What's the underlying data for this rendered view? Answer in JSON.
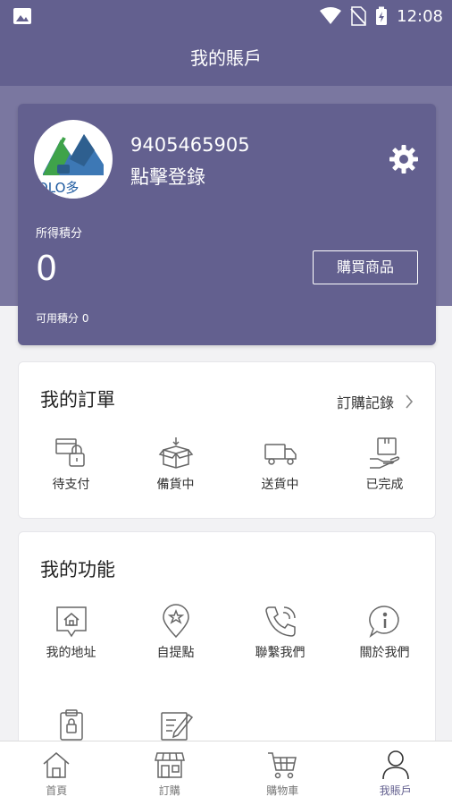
{
  "status_bar": {
    "time": "12:08"
  },
  "header": {
    "title": "我的賬戶"
  },
  "profile": {
    "user_id": "9405465905",
    "login_text": "點擊登錄",
    "points_label": "所得積分",
    "points_value": "0",
    "buy_button": "購買商品",
    "available_points": "可用積分 0",
    "logo_text": "OLO多"
  },
  "orders": {
    "title": "我的訂單",
    "history_link": "訂購記錄",
    "items": [
      {
        "label": "待支付",
        "icon": "pending-payment-icon"
      },
      {
        "label": "備貨中",
        "icon": "preparing-box-icon"
      },
      {
        "label": "送貨中",
        "icon": "delivery-truck-icon"
      },
      {
        "label": "已完成",
        "icon": "completed-package-icon"
      }
    ]
  },
  "features": {
    "title": "我的功能",
    "items": [
      {
        "label": "我的地址",
        "icon": "address-home-icon"
      },
      {
        "label": "自提點",
        "icon": "pickup-location-icon"
      },
      {
        "label": "聯繫我們",
        "icon": "phone-icon"
      },
      {
        "label": "關於我們",
        "icon": "info-icon"
      },
      {
        "label": "",
        "icon": "clipboard-icon"
      },
      {
        "label": "",
        "icon": "edit-note-icon"
      }
    ]
  },
  "bottom_nav": [
    {
      "label": "首頁",
      "icon": "home-icon"
    },
    {
      "label": "訂購",
      "icon": "shop-icon"
    },
    {
      "label": "購物車",
      "icon": "cart-icon"
    },
    {
      "label": "我賬戶",
      "icon": "user-icon",
      "active": true
    }
  ],
  "colors": {
    "primary": "#63608f",
    "band": "#7a77a0",
    "background": "#f2f2f4"
  }
}
